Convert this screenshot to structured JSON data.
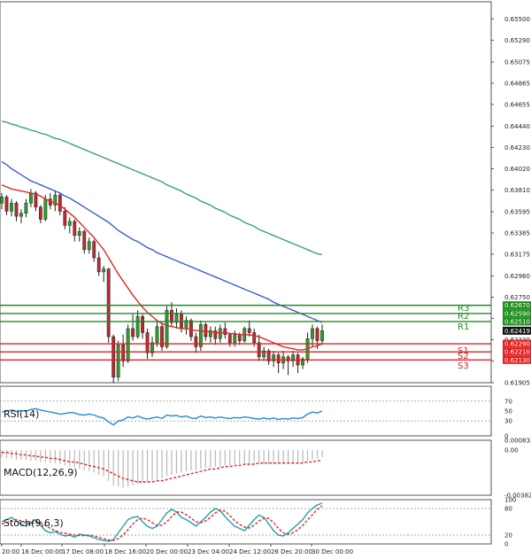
{
  "chart_data": [
    {
      "type": "candlestick",
      "ylim": [
        0.61905,
        0.6567
      ],
      "y_ticks": [
        "0.65500",
        "0.65290",
        "0.65075",
        "0.64865",
        "0.64655",
        "0.64440",
        "0.64230",
        "0.64020",
        "0.63810",
        "0.63595",
        "0.63385",
        "0.63175",
        "0.62960",
        "0.62750",
        "0.62540",
        "0.62330",
        "0.62120",
        "0.61905"
      ],
      "x_ticks": [
        "20:00",
        "16 Dec 00:00",
        "17 Dec 08:00",
        "18 Dec 16:00",
        "20 Dec 00:00",
        "23 Dec 04:00",
        "24 Dec 12:00",
        "26 Dec 20:00",
        "30 Dec 00:00"
      ],
      "current_price": {
        "label": "0.62419",
        "value": 0.62419
      },
      "levels": [
        {
          "name": "R3",
          "value": 0.6267,
          "label": "0.62670",
          "color": "#1e8c1e"
        },
        {
          "name": "R2",
          "value": 0.6259,
          "label": "0.62590",
          "color": "#1e8c1e"
        },
        {
          "name": "R1",
          "value": 0.6251,
          "label": "0.62510",
          "color": "#1e8c1e"
        },
        {
          "name": "S1",
          "value": 0.6229,
          "label": "0.62290",
          "color": "#e02020"
        },
        {
          "name": "S2",
          "value": 0.6221,
          "label": "0.62210",
          "color": "#e02020"
        },
        {
          "name": "S3",
          "value": 0.6213,
          "label": "0.62130",
          "color": "#e02020"
        }
      ],
      "candles": [
        [
          0.6368,
          0.6378,
          0.6362,
          0.6374
        ],
        [
          0.6374,
          0.6376,
          0.6356,
          0.636
        ],
        [
          0.636,
          0.6372,
          0.6355,
          0.6368
        ],
        [
          0.6368,
          0.637,
          0.635,
          0.6355
        ],
        [
          0.6355,
          0.6362,
          0.6348,
          0.6358
        ],
        [
          0.6358,
          0.6372,
          0.6354,
          0.6368
        ],
        [
          0.6368,
          0.6382,
          0.6364,
          0.6378
        ],
        [
          0.6378,
          0.638,
          0.636,
          0.6364
        ],
        [
          0.6364,
          0.6366,
          0.6348,
          0.6352
        ],
        [
          0.6352,
          0.6376,
          0.635,
          0.6372
        ],
        [
          0.6372,
          0.6378,
          0.6362,
          0.6366
        ],
        [
          0.6366,
          0.638,
          0.636,
          0.6376
        ],
        [
          0.6376,
          0.6378,
          0.6356,
          0.636
        ],
        [
          0.636,
          0.6364,
          0.6342,
          0.6346
        ],
        [
          0.6346,
          0.6354,
          0.6338,
          0.635
        ],
        [
          0.635,
          0.6352,
          0.633,
          0.6336
        ],
        [
          0.6336,
          0.6344,
          0.633,
          0.634
        ],
        [
          0.634,
          0.6342,
          0.6318,
          0.6322
        ],
        [
          0.6322,
          0.6334,
          0.6318,
          0.633
        ],
        [
          0.633,
          0.6332,
          0.631,
          0.6314
        ],
        [
          0.6314,
          0.632,
          0.6296,
          0.63
        ],
        [
          0.63,
          0.6306,
          0.629,
          0.6303
        ],
        [
          0.6303,
          0.6304,
          0.623,
          0.6236
        ],
        [
          0.6236,
          0.6238,
          0.619,
          0.6196
        ],
        [
          0.6196,
          0.6232,
          0.6192,
          0.6228
        ],
        [
          0.6228,
          0.6238,
          0.6206,
          0.6212
        ],
        [
          0.6212,
          0.6248,
          0.621,
          0.6244
        ],
        [
          0.6244,
          0.6258,
          0.6232,
          0.6236
        ],
        [
          0.6236,
          0.6262,
          0.6234,
          0.6256
        ],
        [
          0.6256,
          0.6258,
          0.6234,
          0.624
        ],
        [
          0.624,
          0.6244,
          0.6214,
          0.622
        ],
        [
          0.622,
          0.6236,
          0.6216,
          0.623
        ],
        [
          0.623,
          0.6252,
          0.6226,
          0.6246
        ],
        [
          0.6246,
          0.625,
          0.6222,
          0.6226
        ],
        [
          0.6226,
          0.6266,
          0.6224,
          0.6262
        ],
        [
          0.6262,
          0.627,
          0.6246,
          0.625
        ],
        [
          0.625,
          0.6264,
          0.6244,
          0.6258
        ],
        [
          0.6258,
          0.6262,
          0.624,
          0.6244
        ],
        [
          0.6244,
          0.6256,
          0.6238,
          0.6252
        ],
        [
          0.6252,
          0.6254,
          0.6232,
          0.6236
        ],
        [
          0.6236,
          0.624,
          0.622,
          0.6226
        ],
        [
          0.6226,
          0.6252,
          0.6222,
          0.6248
        ],
        [
          0.6248,
          0.625,
          0.6232,
          0.6236
        ],
        [
          0.6236,
          0.6246,
          0.623,
          0.6242
        ],
        [
          0.6242,
          0.6246,
          0.6228,
          0.6234
        ],
        [
          0.6234,
          0.6248,
          0.623,
          0.6244
        ],
        [
          0.6244,
          0.625,
          0.6234,
          0.6238
        ],
        [
          0.6238,
          0.624,
          0.6226,
          0.623
        ],
        [
          0.623,
          0.6242,
          0.6226,
          0.6238
        ],
        [
          0.6238,
          0.624,
          0.6228,
          0.6232
        ],
        [
          0.6232,
          0.6246,
          0.623,
          0.6244
        ],
        [
          0.6244,
          0.6252,
          0.6236,
          0.624
        ],
        [
          0.624,
          0.6244,
          0.6226,
          0.623
        ],
        [
          0.623,
          0.6238,
          0.6212,
          0.6216
        ],
        [
          0.6216,
          0.6226,
          0.6212,
          0.6222
        ],
        [
          0.6222,
          0.6224,
          0.6208,
          0.6212
        ],
        [
          0.6212,
          0.6222,
          0.6206,
          0.6218
        ],
        [
          0.6218,
          0.622,
          0.62,
          0.621
        ],
        [
          0.621,
          0.6222,
          0.6204,
          0.6216
        ],
        [
          0.6216,
          0.6218,
          0.6198,
          0.6212
        ],
        [
          0.6212,
          0.6222,
          0.6206,
          0.6218
        ],
        [
          0.6218,
          0.622,
          0.62,
          0.6208
        ],
        [
          0.6208,
          0.6216,
          0.6204,
          0.6214
        ],
        [
          0.6214,
          0.624,
          0.621,
          0.6234
        ],
        [
          0.6234,
          0.6248,
          0.6226,
          0.6244
        ],
        [
          0.6244,
          0.6246,
          0.6224,
          0.6232
        ],
        [
          0.6232,
          0.6248,
          0.6228,
          0.6242
        ]
      ],
      "ma_fast": [
        0.6386,
        0.6384,
        0.6382,
        0.6381,
        0.638,
        0.6379,
        0.6378,
        0.6377,
        0.6375,
        0.6372,
        0.637,
        0.6368,
        0.6366,
        0.6362,
        0.6358,
        0.6354,
        0.6349,
        0.6344,
        0.6339,
        0.6334,
        0.6328,
        0.6322,
        0.6314,
        0.6306,
        0.6298,
        0.6291,
        0.6284,
        0.6277,
        0.6271,
        0.6265,
        0.626,
        0.6256,
        0.6252,
        0.6249,
        0.6247,
        0.6246,
        0.6245,
        0.6244,
        0.6244,
        0.6243,
        0.6242,
        0.6242,
        0.6241,
        0.6241,
        0.624,
        0.624,
        0.624,
        0.6239,
        0.6239,
        0.6238,
        0.6238,
        0.6238,
        0.6237,
        0.6236,
        0.6234,
        0.6232,
        0.623,
        0.6228,
        0.6226,
        0.6225,
        0.6224,
        0.6223,
        0.6223,
        0.6224,
        0.6226,
        0.6227,
        0.6229
      ],
      "ma_mid": [
        0.6409,
        0.6406,
        0.6402,
        0.6399,
        0.6396,
        0.6393,
        0.639,
        0.6388,
        0.6386,
        0.6384,
        0.6382,
        0.638,
        0.6378,
        0.6375,
        0.6373,
        0.637,
        0.6367,
        0.6364,
        0.6361,
        0.6358,
        0.6355,
        0.6352,
        0.6349,
        0.6345,
        0.6341,
        0.6338,
        0.6335,
        0.6332,
        0.633,
        0.6327,
        0.6324,
        0.6322,
        0.6319,
        0.6317,
        0.6315,
        0.6313,
        0.6311,
        0.6309,
        0.6307,
        0.6305,
        0.6303,
        0.6301,
        0.6299,
        0.6297,
        0.6295,
        0.6293,
        0.6291,
        0.6289,
        0.6287,
        0.6285,
        0.6283,
        0.6281,
        0.6279,
        0.6277,
        0.6275,
        0.6273,
        0.627,
        0.6268,
        0.6266,
        0.6264,
        0.6262,
        0.626,
        0.6258,
        0.6256,
        0.6254,
        0.6252,
        0.625
      ],
      "ma_slow": [
        0.6449,
        0.6448,
        0.6446,
        0.6445,
        0.6443,
        0.6442,
        0.644,
        0.6439,
        0.6437,
        0.6436,
        0.6434,
        0.6432,
        0.6431,
        0.6429,
        0.6427,
        0.6425,
        0.6423,
        0.6421,
        0.6419,
        0.6417,
        0.6415,
        0.6413,
        0.6411,
        0.6409,
        0.6407,
        0.6405,
        0.6403,
        0.6401,
        0.6399,
        0.6397,
        0.6395,
        0.6393,
        0.6391,
        0.6389,
        0.6386,
        0.6384,
        0.6382,
        0.638,
        0.6377,
        0.6375,
        0.6373,
        0.637,
        0.6368,
        0.6366,
        0.6363,
        0.6361,
        0.6359,
        0.6356,
        0.6354,
        0.6352,
        0.6349,
        0.6347,
        0.6345,
        0.6342,
        0.634,
        0.6338,
        0.6336,
        0.6334,
        0.6332,
        0.633,
        0.6328,
        0.6326,
        0.6324,
        0.6322,
        0.632,
        0.6318,
        0.6317
      ]
    },
    {
      "type": "line",
      "label": "RSI(14)",
      "ylim": [
        0,
        100
      ],
      "y_ticks": [
        "70",
        "50",
        "30",
        "0"
      ],
      "values": [
        48,
        50,
        52,
        49,
        51,
        50,
        53,
        55,
        52,
        50,
        48,
        46,
        44,
        45,
        47,
        46,
        43,
        42,
        44,
        42,
        38,
        36,
        28,
        22,
        30,
        32,
        38,
        36,
        40,
        36,
        34,
        36,
        38,
        35,
        42,
        40,
        41,
        38,
        40,
        36,
        35,
        40,
        37,
        38,
        36,
        38,
        36,
        35,
        37,
        36,
        38,
        37,
        35,
        34,
        36,
        34,
        36,
        33,
        35,
        34,
        36,
        35,
        37,
        44,
        48,
        46,
        50
      ]
    },
    {
      "type": "bar",
      "label": "MACD(12,26,9)",
      "ylim": [
        -0.003827,
        0.000833
      ],
      "y_ticks": [
        "0.000833",
        "0.00",
        "-0.003827"
      ],
      "values": [
        -0.0006,
        -0.0007,
        -0.0007,
        -0.0008,
        -0.0008,
        -0.0008,
        -0.0009,
        -0.0009,
        -0.001,
        -0.001,
        -0.0011,
        -0.0011,
        -0.0012,
        -0.0013,
        -0.0014,
        -0.0015,
        -0.0016,
        -0.0017,
        -0.0018,
        -0.0019,
        -0.0021,
        -0.0022,
        -0.0026,
        -0.003,
        -0.0031,
        -0.0032,
        -0.0031,
        -0.003,
        -0.0029,
        -0.0028,
        -0.0027,
        -0.0026,
        -0.0025,
        -0.0024,
        -0.0022,
        -0.0021,
        -0.002,
        -0.0019,
        -0.0018,
        -0.0017,
        -0.0017,
        -0.0016,
        -0.0015,
        -0.0015,
        -0.0014,
        -0.0014,
        -0.0013,
        -0.0013,
        -0.0012,
        -0.0012,
        -0.0011,
        -0.0011,
        -0.0011,
        -0.0011,
        -0.0012,
        -0.0012,
        -0.0012,
        -0.0012,
        -0.0012,
        -0.0012,
        -0.0012,
        -0.0012,
        -0.0011,
        -0.0009,
        -0.0008,
        -0.0007,
        -0.0006
      ],
      "signal": [
        -0.0002,
        -0.0002,
        -0.0003,
        -0.0003,
        -0.0004,
        -0.0004,
        -0.0005,
        -0.0005,
        -0.0006,
        -0.0006,
        -0.0007,
        -0.0007,
        -0.0008,
        -0.0009,
        -0.001,
        -0.001,
        -0.0011,
        -0.0012,
        -0.0013,
        -0.0014,
        -0.0015,
        -0.0016,
        -0.0018,
        -0.002,
        -0.0022,
        -0.0024,
        -0.0025,
        -0.0026,
        -0.0027,
        -0.0027,
        -0.0027,
        -0.0027,
        -0.0026,
        -0.0026,
        -0.0025,
        -0.0024,
        -0.0023,
        -0.0022,
        -0.0021,
        -0.002,
        -0.0019,
        -0.0018,
        -0.0017,
        -0.0016,
        -0.0016,
        -0.0015,
        -0.0014,
        -0.0014,
        -0.0013,
        -0.0013,
        -0.0012,
        -0.0012,
        -0.0012,
        -0.0011,
        -0.0011,
        -0.0011,
        -0.0011,
        -0.0011,
        -0.0011,
        -0.0011,
        -0.0011,
        -0.0011,
        -0.0011,
        -0.001,
        -0.001,
        -0.0009,
        -0.0009
      ]
    },
    {
      "type": "line",
      "label": "Stoch(9,6,3)",
      "ylim": [
        0,
        100
      ],
      "y_ticks": [
        "100",
        "80",
        "20",
        "0"
      ],
      "k": [
        50,
        55,
        60,
        52,
        45,
        40,
        48,
        55,
        42,
        30,
        25,
        28,
        22,
        18,
        20,
        15,
        22,
        20,
        18,
        14,
        10,
        8,
        6,
        10,
        25,
        40,
        55,
        60,
        62,
        50,
        40,
        35,
        40,
        55,
        70,
        78,
        72,
        60,
        55,
        48,
        40,
        50,
        60,
        72,
        80,
        75,
        62,
        50,
        40,
        35,
        30,
        42,
        55,
        65,
        60,
        45,
        30,
        20,
        18,
        25,
        35,
        45,
        55,
        70,
        80,
        88,
        92
      ],
      "d": [
        45,
        48,
        52,
        55,
        52,
        48,
        46,
        48,
        48,
        42,
        35,
        30,
        26,
        24,
        22,
        20,
        19,
        19,
        20,
        18,
        15,
        12,
        9,
        8,
        12,
        20,
        32,
        45,
        55,
        58,
        55,
        48,
        42,
        42,
        50,
        62,
        72,
        72,
        66,
        58,
        50,
        48,
        52,
        60,
        70,
        76,
        74,
        64,
        52,
        44,
        38,
        36,
        42,
        52,
        58,
        58,
        48,
        35,
        25,
        22,
        25,
        32,
        42,
        54,
        66,
        78,
        86
      ]
    }
  ]
}
